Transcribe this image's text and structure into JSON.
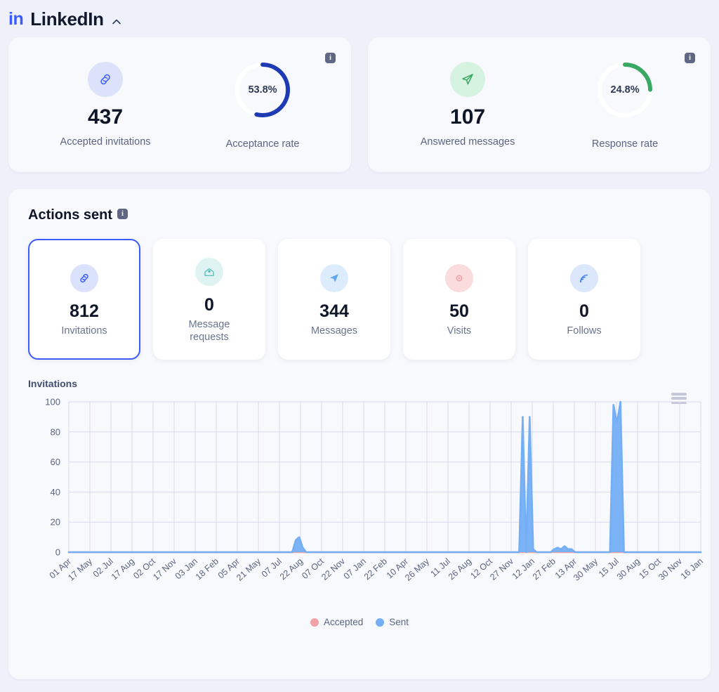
{
  "header": {
    "logo_text": "in",
    "title": "LinkedIn",
    "collapse_icon": "chevron-up-icon"
  },
  "colors": {
    "page_bg": "#eef1f9",
    "card_bg": "#f8f9fd",
    "accent_blue": "#3b5bfd",
    "donut_blue": "#1f3bb3",
    "donut_green": "#3aa863",
    "series_sent": "#74aff5",
    "series_accepted": "#f2a3a8",
    "text_dark": "#0e1628",
    "text_muted": "#5a6480",
    "grid": "#d6dbeb"
  },
  "top_cards": [
    {
      "info_badge": "i",
      "metric": {
        "icon": "link-icon",
        "icon_bg": "#dce2fa",
        "icon_color": "#3b5bfd",
        "value": "437",
        "label": "Accepted invitations"
      },
      "donut": {
        "value_text": "53.8%",
        "percent": 53.8,
        "label": "Acceptance rate",
        "color": "#1f3bb3",
        "track": "#ffffff"
      }
    },
    {
      "info_badge": "i",
      "metric": {
        "icon": "send-plane-icon",
        "icon_bg": "#d6f2e1",
        "icon_color": "#3aa863",
        "value": "107",
        "label": "Answered messages"
      },
      "donut": {
        "value_text": "24.8%",
        "percent": 24.8,
        "label": "Response rate",
        "color": "#3aa863",
        "track": "#ffffff"
      }
    }
  ],
  "actions_panel": {
    "title": "Actions sent",
    "info_badge": "i",
    "tiles": [
      {
        "icon": "link-icon",
        "icon_bg": "#dbe2fb",
        "icon_color": "#3b5bfd",
        "value": "812",
        "label": "Invitations",
        "selected": true
      },
      {
        "icon": "inbox-envelope-icon",
        "icon_bg": "#dff4f2",
        "icon_color": "#56bfbb",
        "value": "0",
        "label": "Message requests",
        "selected": false
      },
      {
        "icon": "send-plane-icon",
        "icon_bg": "#ddecfc",
        "icon_color": "#62a8f0",
        "value": "344",
        "label": "Messages",
        "selected": false
      },
      {
        "icon": "target-dot-icon",
        "icon_bg": "#fadcdc",
        "icon_color": "#ef9ea3",
        "value": "50",
        "label": "Visits",
        "selected": false
      },
      {
        "icon": "rss-feed-icon",
        "icon_bg": "#dbe7fb",
        "icon_color": "#4c87ef",
        "value": "0",
        "label": "Follows",
        "selected": false
      }
    ],
    "chart_menu_icon": "hamburger-menu-icon"
  },
  "chart_data": {
    "type": "line",
    "title": "Invitations",
    "xlabel": "",
    "ylabel": "",
    "ylim": [
      0,
      100
    ],
    "yticks": [
      0,
      20,
      40,
      60,
      80,
      100
    ],
    "grid": true,
    "legend_position": "bottom",
    "x_tick_labels": [
      "01 Apr",
      "17 May",
      "02 Jul",
      "17 Aug",
      "02 Oct",
      "17 Nov",
      "03 Jan",
      "18 Feb",
      "05 Apr",
      "21 May",
      "07 Jul",
      "22 Aug",
      "07 Oct",
      "22 Nov",
      "07 Jan",
      "22 Feb",
      "10 Apr",
      "26 May",
      "11 Jul",
      "26 Aug",
      "12 Oct",
      "27 Nov",
      "12 Jan",
      "27 Feb",
      "13 Apr",
      "30 May",
      "15 Jul",
      "30 Aug",
      "15 Oct",
      "30 Nov",
      "16 Jan"
    ],
    "series": [
      {
        "name": "Accepted",
        "color": "#f2a3a8",
        "values": [
          0,
          0,
          0,
          0,
          0,
          0,
          0,
          0,
          0,
          0,
          0,
          0,
          0,
          0,
          0,
          0,
          0,
          0,
          0,
          0,
          0,
          0,
          0,
          0,
          0,
          0,
          0,
          0,
          0,
          0,
          0,
          0,
          0,
          0,
          0,
          0,
          0,
          0,
          0,
          0,
          0,
          0,
          0,
          0,
          0,
          0,
          0,
          0,
          0,
          0,
          0,
          0,
          0,
          0,
          0,
          0,
          0,
          0,
          0,
          0,
          0,
          0,
          0,
          0,
          0,
          0,
          0,
          0,
          0,
          0,
          0,
          0,
          0,
          0,
          0,
          0,
          0,
          0,
          0,
          0,
          0,
          0,
          0,
          0,
          0,
          0,
          0,
          0,
          0,
          0,
          0,
          0,
          0,
          0,
          0,
          0,
          0,
          0,
          0,
          0,
          0,
          0,
          0,
          0,
          0,
          0,
          0,
          0,
          0,
          0,
          0,
          0,
          0,
          0,
          0,
          0,
          0,
          0,
          0,
          0,
          0,
          0,
          0,
          0,
          0,
          0,
          0,
          0,
          0,
          0,
          0,
          0,
          0,
          0,
          0,
          0,
          0,
          0,
          0,
          0,
          0,
          0,
          0,
          0,
          0,
          0,
          0,
          0,
          0,
          0,
          0,
          0,
          0,
          0,
          0,
          0,
          0,
          0,
          0,
          0
        ]
      },
      {
        "name": "Sent",
        "color": "#74aff5",
        "values": [
          0,
          0,
          0,
          0,
          0,
          0,
          0,
          0,
          0,
          0,
          0,
          0,
          0,
          0,
          0,
          0,
          0,
          0,
          0,
          0,
          0,
          0,
          0,
          0,
          0,
          0,
          0,
          0,
          0,
          0,
          0,
          0,
          0,
          0,
          0,
          0,
          0,
          0,
          0,
          0,
          0,
          0,
          0,
          0,
          0,
          0,
          0,
          0,
          0,
          0,
          0,
          0,
          0,
          0,
          0,
          0,
          0,
          0,
          0,
          0,
          0,
          0,
          0,
          0,
          0,
          8,
          10,
          3,
          0,
          0,
          0,
          0,
          0,
          0,
          0,
          0,
          0,
          0,
          0,
          0,
          0,
          0,
          0,
          0,
          0,
          0,
          0,
          0,
          0,
          0,
          0,
          0,
          0,
          0,
          0,
          0,
          0,
          0,
          0,
          0,
          0,
          0,
          0,
          0,
          0,
          0,
          0,
          0,
          0,
          0,
          0,
          0,
          0,
          0,
          0,
          0,
          0,
          0,
          0,
          0,
          0,
          0,
          0,
          0,
          0,
          0,
          0,
          0,
          0,
          0,
          90,
          0,
          90,
          2,
          0,
          0,
          0,
          0,
          0,
          2,
          3,
          2,
          4,
          2,
          2,
          0,
          0,
          0,
          0,
          0,
          0,
          0,
          0,
          0,
          0,
          0,
          98,
          86,
          100,
          0,
          0,
          0,
          0,
          0,
          0,
          0,
          0,
          0,
          0,
          0,
          0,
          0,
          0,
          0,
          0,
          0,
          0,
          0,
          0,
          0,
          0,
          0
        ]
      }
    ],
    "legend": [
      {
        "name": "Accepted",
        "color": "#f2a3a8"
      },
      {
        "name": "Sent",
        "color": "#74aff5"
      }
    ]
  }
}
